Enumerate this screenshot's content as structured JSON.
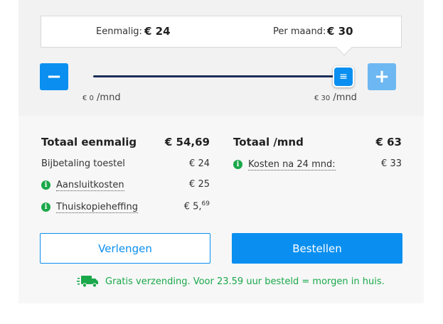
{
  "price_box": {
    "one_time_label": "Eenmalig:",
    "one_time_value": "€ 24",
    "monthly_label": "Per maand:",
    "monthly_value": "€ 30"
  },
  "slider": {
    "minus_label": "−",
    "plus_label": "+",
    "handle_glyph": "≡",
    "min_currency": "€ 0",
    "min_unit": " /mnd",
    "max_currency": "€ 30",
    "max_unit": " /mnd",
    "value_fraction": 1.0
  },
  "totals": {
    "one_time": {
      "label": "Totaal eenmalig",
      "value": "€ 54,69",
      "items": [
        {
          "label": "Bijbetaling toestel",
          "value": "€ 24",
          "info": false
        },
        {
          "label": "Aansluitkosten",
          "value": "€ 25",
          "info": true
        },
        {
          "label": "Thuiskopieheffing",
          "value_main": "€ 5,",
          "value_sup": "69",
          "info": true
        }
      ]
    },
    "monthly": {
      "label": "Totaal /mnd",
      "value": "€ 63",
      "items": [
        {
          "label": "Kosten na 24 mnd:",
          "value": "€ 33",
          "info": true
        }
      ]
    }
  },
  "buttons": {
    "extend": "Verlengen",
    "order": "Bestellen"
  },
  "shipping": {
    "text": "Gratis verzending. Voor 23.59 uur besteld = morgen in huis.",
    "icon": "truck-icon"
  },
  "colors": {
    "primary": "#0a8ff0",
    "primary_light": "#6db8f2",
    "track": "#1c2f57",
    "success": "#1aa84a"
  }
}
